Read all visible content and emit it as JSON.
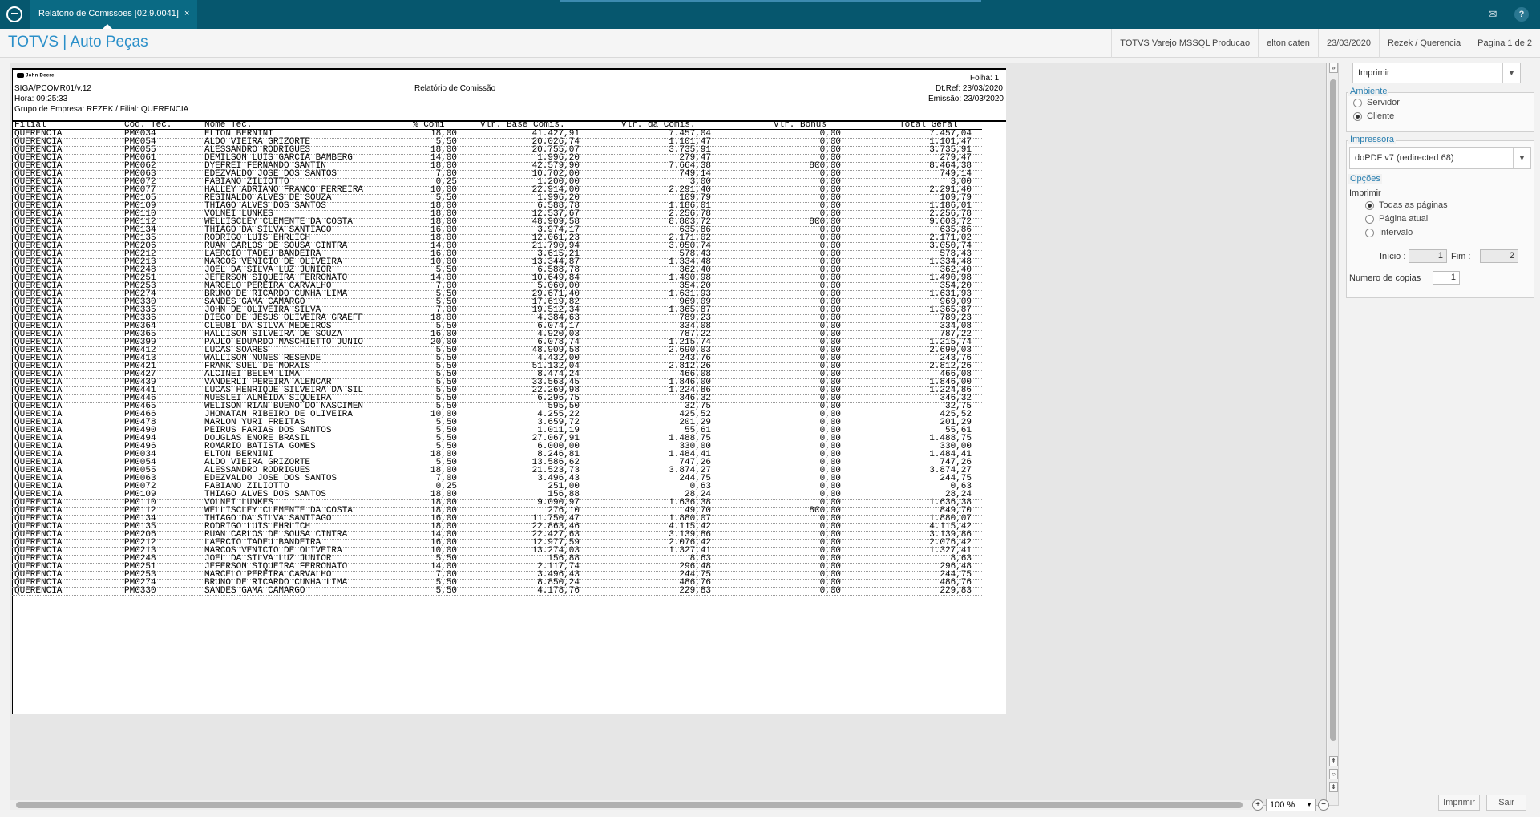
{
  "topbar": {
    "tab_title": "Relatorio de Comissoes [02.9.0041]",
    "tab_close": "×"
  },
  "header": {
    "brand": "TOTVS | Auto Peças",
    "environment": "TOTVS Varejo MSSQL Producao",
    "user": "elton.caten",
    "date": "23/03/2020",
    "company": "Rezek / Querencia",
    "page": "Pagina 1 de 2"
  },
  "report": {
    "logo_text": "John Deere",
    "program": "SIGA/PCOMR01/v.12",
    "hora": "Hora: 09:25:33",
    "grupo": "Grupo de Empresa: REZEK / Filial: QUERENCIA",
    "title": "Relatório de Comissão",
    "folha": "Folha:  1",
    "dtref": "Dt.Ref: 23/03/2020",
    "emissao": "Emissão: 23/03/2020",
    "columns": [
      "Filial",
      "Cod. Tec.",
      "Nome Tec.",
      "% Comi",
      "Vlr. Base Comis.",
      "Vlr. da Comis.",
      "Vlr. Bonus",
      "Total Geral"
    ],
    "rows": [
      [
        "QUERENCIA",
        "PM0034",
        "ELTON BERNINI",
        "18,00",
        "41.427,91",
        "7.457,04",
        "0,00",
        "7.457,04"
      ],
      [
        "QUERENCIA",
        "PM0054",
        "ALDO VIEIRA GRIZORTE",
        "5,50",
        "20.026,74",
        "1.101,47",
        "0,00",
        "1.101,47"
      ],
      [
        "QUERENCIA",
        "PM0055",
        "ALESSANDRO RODRIGUES",
        "18,00",
        "20.755,07",
        "3.735,91",
        "0,00",
        "3.735,91"
      ],
      [
        "QUERENCIA",
        "PM0061",
        "DEMILSON LUIS GARCIA BAMBERG",
        "14,00",
        "1.996,20",
        "279,47",
        "0,00",
        "279,47"
      ],
      [
        "QUERENCIA",
        "PM0062",
        "DYEFREI FERNANDO SANTIN",
        "18,00",
        "42.579,90",
        "7.664,38",
        "800,00",
        "8.464,38"
      ],
      [
        "QUERENCIA",
        "PM0063",
        "EDEZVALDO JOSE DOS SANTOS",
        "7,00",
        "10.702,00",
        "749,14",
        "0,00",
        "749,14"
      ],
      [
        "QUERENCIA",
        "PM0072",
        "FABIANO ZILIOTTO",
        "0,25",
        "1.200,00",
        "3,00",
        "0,00",
        "3,00"
      ],
      [
        "QUERENCIA",
        "PM0077",
        "HALLEY ADRIANO FRANCO FERREIRA",
        "10,00",
        "22.914,00",
        "2.291,40",
        "0,00",
        "2.291,40"
      ],
      [
        "QUERENCIA",
        "PM0105",
        "REGINALDO ALVES DE SOUZA",
        "5,50",
        "1.996,20",
        "109,79",
        "0,00",
        "109,79"
      ],
      [
        "QUERENCIA",
        "PM0109",
        "THIAGO ALVES DOS SANTOS",
        "18,00",
        "6.588,78",
        "1.186,01",
        "0,00",
        "1.186,01"
      ],
      [
        "QUERENCIA",
        "PM0110",
        "VOLNEI LUNKES",
        "18,00",
        "12.537,67",
        "2.256,78",
        "0,00",
        "2.256,78"
      ],
      [
        "QUERENCIA",
        "PM0112",
        "WELLISCLEY CLEMENTE DA COSTA",
        "18,00",
        "48.909,58",
        "8.803,72",
        "800,00",
        "9.603,72"
      ],
      [
        "QUERENCIA",
        "PM0134",
        "THIAGO DA SILVA SANTIAGO",
        "16,00",
        "3.974,17",
        "635,86",
        "0,00",
        "635,86"
      ],
      [
        "QUERENCIA",
        "PM0135",
        "RODRIGO LUIS EHRLICH",
        "18,00",
        "12.061,23",
        "2.171,02",
        "0,00",
        "2.171,02"
      ],
      [
        "QUERENCIA",
        "PM0206",
        "RUAN CARLOS DE SOUSA CINTRA",
        "14,00",
        "21.790,94",
        "3.050,74",
        "0,00",
        "3.050,74"
      ],
      [
        "QUERENCIA",
        "PM0212",
        "LAERCIO TADEU BANDEIRA",
        "16,00",
        "3.615,21",
        "578,43",
        "0,00",
        "578,43"
      ],
      [
        "QUERENCIA",
        "PM0213",
        "MARCOS VENICIO DE OLIVEIRA",
        "10,00",
        "13.344,87",
        "1.334,48",
        "0,00",
        "1.334,48"
      ],
      [
        "QUERENCIA",
        "PM0248",
        "JOEL DA SILVA LUZ JUNIOR",
        "5,50",
        "6.588,78",
        "362,40",
        "0,00",
        "362,40"
      ],
      [
        "QUERENCIA",
        "PM0251",
        "JEFERSON SIQUEIRA  FERRONATO",
        "14,00",
        "10.649,84",
        "1.490,98",
        "0,00",
        "1.490,98"
      ],
      [
        "QUERENCIA",
        "PM0253",
        "MARCELO PEREIRA CARVALHO",
        "7,00",
        "5.060,00",
        "354,20",
        "0,00",
        "354,20"
      ],
      [
        "QUERENCIA",
        "PM0274",
        "BRUNO DE RICARDO CUNHA LIMA",
        "5,50",
        "29.671,40",
        "1.631,93",
        "0,00",
        "1.631,93"
      ],
      [
        "QUERENCIA",
        "PM0330",
        "SANDES GAMA CAMARGO",
        "5,50",
        "17.619,82",
        "969,09",
        "0,00",
        "969,09"
      ],
      [
        "QUERENCIA",
        "PM0335",
        "JOHN DE OLIVEIRA SILVA",
        "7,00",
        "19.512,34",
        "1.365,87",
        "0,00",
        "1.365,87"
      ],
      [
        "QUERENCIA",
        "PM0336",
        "DIEGO DE JESUS OLIVEIRA GRAEFF",
        "18,00",
        "4.384,63",
        "789,23",
        "0,00",
        "789,23"
      ],
      [
        "QUERENCIA",
        "PM0364",
        "CLEUBI DA SILVA MEDEIROS",
        "5,50",
        "6.074,17",
        "334,08",
        "0,00",
        "334,08"
      ],
      [
        "QUERENCIA",
        "PM0365",
        "HALLISON SILVEIRA DE SOUZA",
        "16,00",
        "4.920,03",
        "787,22",
        "0,00",
        "787,22"
      ],
      [
        "QUERENCIA",
        "PM0399",
        "PAULO EDUARDO MASCHIETTO JUNIO",
        "20,00",
        "6.078,74",
        "1.215,74",
        "0,00",
        "1.215,74"
      ],
      [
        "QUERENCIA",
        "PM0412",
        "LUCAS SOARES",
        "5,50",
        "48.909,58",
        "2.690,03",
        "0,00",
        "2.690,03"
      ],
      [
        "QUERENCIA",
        "PM0413",
        "WALLISON NUNES RESENDE",
        "5,50",
        "4.432,00",
        "243,76",
        "0,00",
        "243,76"
      ],
      [
        "QUERENCIA",
        "PM0421",
        "FRANK SUEL DE MORAIS",
        "5,50",
        "51.132,04",
        "2.812,26",
        "0,00",
        "2.812,26"
      ],
      [
        "QUERENCIA",
        "PM0427",
        "ALCINEI BELEM LIMA",
        "5,50",
        "8.474,24",
        "466,08",
        "0,00",
        "466,08"
      ],
      [
        "QUERENCIA",
        "PM0439",
        "VANDERLI PEREIRA ALENCAR",
        "5,50",
        "33.563,45",
        "1.846,00",
        "0,00",
        "1.846,00"
      ],
      [
        "QUERENCIA",
        "PM0441",
        "LUCAS HENRIQUE SILVEIRA DA SIL",
        "5,50",
        "22.269,98",
        "1.224,86",
        "0,00",
        "1.224,86"
      ],
      [
        "QUERENCIA",
        "PM0446",
        "NUESLEI ALMEIDA SIQUEIRA",
        "5,50",
        "6.296,75",
        "346,32",
        "0,00",
        "346,32"
      ],
      [
        "QUERENCIA",
        "PM0465",
        "WELISON RIAN BUENO DO NASCIMEN",
        "5,50",
        "595,50",
        "32,75",
        "0,00",
        "32,75"
      ],
      [
        "QUERENCIA",
        "PM0466",
        "JHONATAN RIBEIRO DE OLIVEIRA",
        "10,00",
        "4.255,22",
        "425,52",
        "0,00",
        "425,52"
      ],
      [
        "QUERENCIA",
        "PM0478",
        "MARLON YURI FREITAS",
        "5,50",
        "3.659,72",
        "201,29",
        "0,00",
        "201,29"
      ],
      [
        "QUERENCIA",
        "PM0490",
        "PEIRUS FARIAS DOS SANTOS",
        "5,50",
        "1.011,19",
        "55,61",
        "0,00",
        "55,61"
      ],
      [
        "QUERENCIA",
        "PM0494",
        "DOUGLAS ENORE BRASIL",
        "5,50",
        "27.067,91",
        "1.488,75",
        "0,00",
        "1.488,75"
      ],
      [
        "QUERENCIA",
        "PM0496",
        "ROMARIO BATISTA GOMES",
        "5,50",
        "6.000,00",
        "330,00",
        "0,00",
        "330,00"
      ],
      [
        "QUERENCIA",
        "PM0034",
        "ELTON BERNINI",
        "18,00",
        "8.246,81",
        "1.484,41",
        "0,00",
        "1.484,41"
      ],
      [
        "QUERENCIA",
        "PM0054",
        "ALDO VIEIRA GRIZORTE",
        "5,50",
        "13.586,62",
        "747,26",
        "0,00",
        "747,26"
      ],
      [
        "QUERENCIA",
        "PM0055",
        "ALESSANDRO RODRIGUES",
        "18,00",
        "21.523,73",
        "3.874,27",
        "0,00",
        "3.874,27"
      ],
      [
        "QUERENCIA",
        "PM0063",
        "EDEZVALDO JOSE DOS SANTOS",
        "7,00",
        "3.496,43",
        "244,75",
        "0,00",
        "244,75"
      ],
      [
        "QUERENCIA",
        "PM0072",
        "FABIANO ZILIOTTO",
        "0,25",
        "251,00",
        "0,63",
        "0,00",
        "0,63"
      ],
      [
        "QUERENCIA",
        "PM0109",
        "THIAGO ALVES DOS SANTOS",
        "18,00",
        "156,88",
        "28,24",
        "0,00",
        "28,24"
      ],
      [
        "QUERENCIA",
        "PM0110",
        "VOLNEI LUNKES",
        "18,00",
        "9.090,97",
        "1.636,38",
        "0,00",
        "1.636,38"
      ],
      [
        "QUERENCIA",
        "PM0112",
        "WELLISCLEY CLEMENTE DA COSTA",
        "18,00",
        "276,10",
        "49,70",
        "800,00",
        "849,70"
      ],
      [
        "QUERENCIA",
        "PM0134",
        "THIAGO DA SILVA SANTIAGO",
        "16,00",
        "11.750,47",
        "1.880,07",
        "0,00",
        "1.880,07"
      ],
      [
        "QUERENCIA",
        "PM0135",
        "RODRIGO LUIS EHRLICH",
        "18,00",
        "22.863,46",
        "4.115,42",
        "0,00",
        "4.115,42"
      ],
      [
        "QUERENCIA",
        "PM0206",
        "RUAN CARLOS DE SOUSA CINTRA",
        "14,00",
        "22.427,63",
        "3.139,86",
        "0,00",
        "3.139,86"
      ],
      [
        "QUERENCIA",
        "PM0212",
        "LAERCIO TADEU BANDEIRA",
        "16,00",
        "12.977,59",
        "2.076,42",
        "0,00",
        "2.076,42"
      ],
      [
        "QUERENCIA",
        "PM0213",
        "MARCOS VENICIO DE OLIVEIRA",
        "10,00",
        "13.274,03",
        "1.327,41",
        "0,00",
        "1.327,41"
      ],
      [
        "QUERENCIA",
        "PM0248",
        "JOEL DA SILVA LUZ JUNIOR",
        "5,50",
        "156,88",
        "8,63",
        "0,00",
        "8,63"
      ],
      [
        "QUERENCIA",
        "PM0251",
        "JEFERSON SIQUEIRA  FERRONATO",
        "14,00",
        "2.117,74",
        "296,48",
        "0,00",
        "296,48"
      ],
      [
        "QUERENCIA",
        "PM0253",
        "MARCELO PEREIRA CARVALHO",
        "7,00",
        "3.496,43",
        "244,75",
        "0,00",
        "244,75"
      ],
      [
        "QUERENCIA",
        "PM0274",
        "BRUNO DE RICARDO CUNHA LIMA",
        "5,50",
        "8.850,24",
        "486,76",
        "0,00",
        "486,76"
      ],
      [
        "QUERENCIA",
        "PM0330",
        "SANDES GAMA CAMARGO",
        "5,50",
        "4.178,76",
        "229,83",
        "0,00",
        "229,83"
      ]
    ]
  },
  "zoom": {
    "value": "100 %"
  },
  "panel": {
    "action_combo": "Imprimir",
    "ambiente_title": "Ambiente",
    "servidor": "Servidor",
    "cliente": "Cliente",
    "impressora_title": "Impressora",
    "printer": "doPDF v7 (redirected 68)",
    "opcoes_title": "Opções",
    "imprimir_label": "Imprimir",
    "todas": "Todas as páginas",
    "atual": "Página atual",
    "intervalo": "Intervalo",
    "inicio_label": "Início :",
    "inicio_value": "1",
    "fim_label": "Fim :",
    "fim_value": "2",
    "copias_label": "Numero de copias",
    "copias_value": "1",
    "print_button": "Imprimir",
    "exit_button": "Sair"
  }
}
